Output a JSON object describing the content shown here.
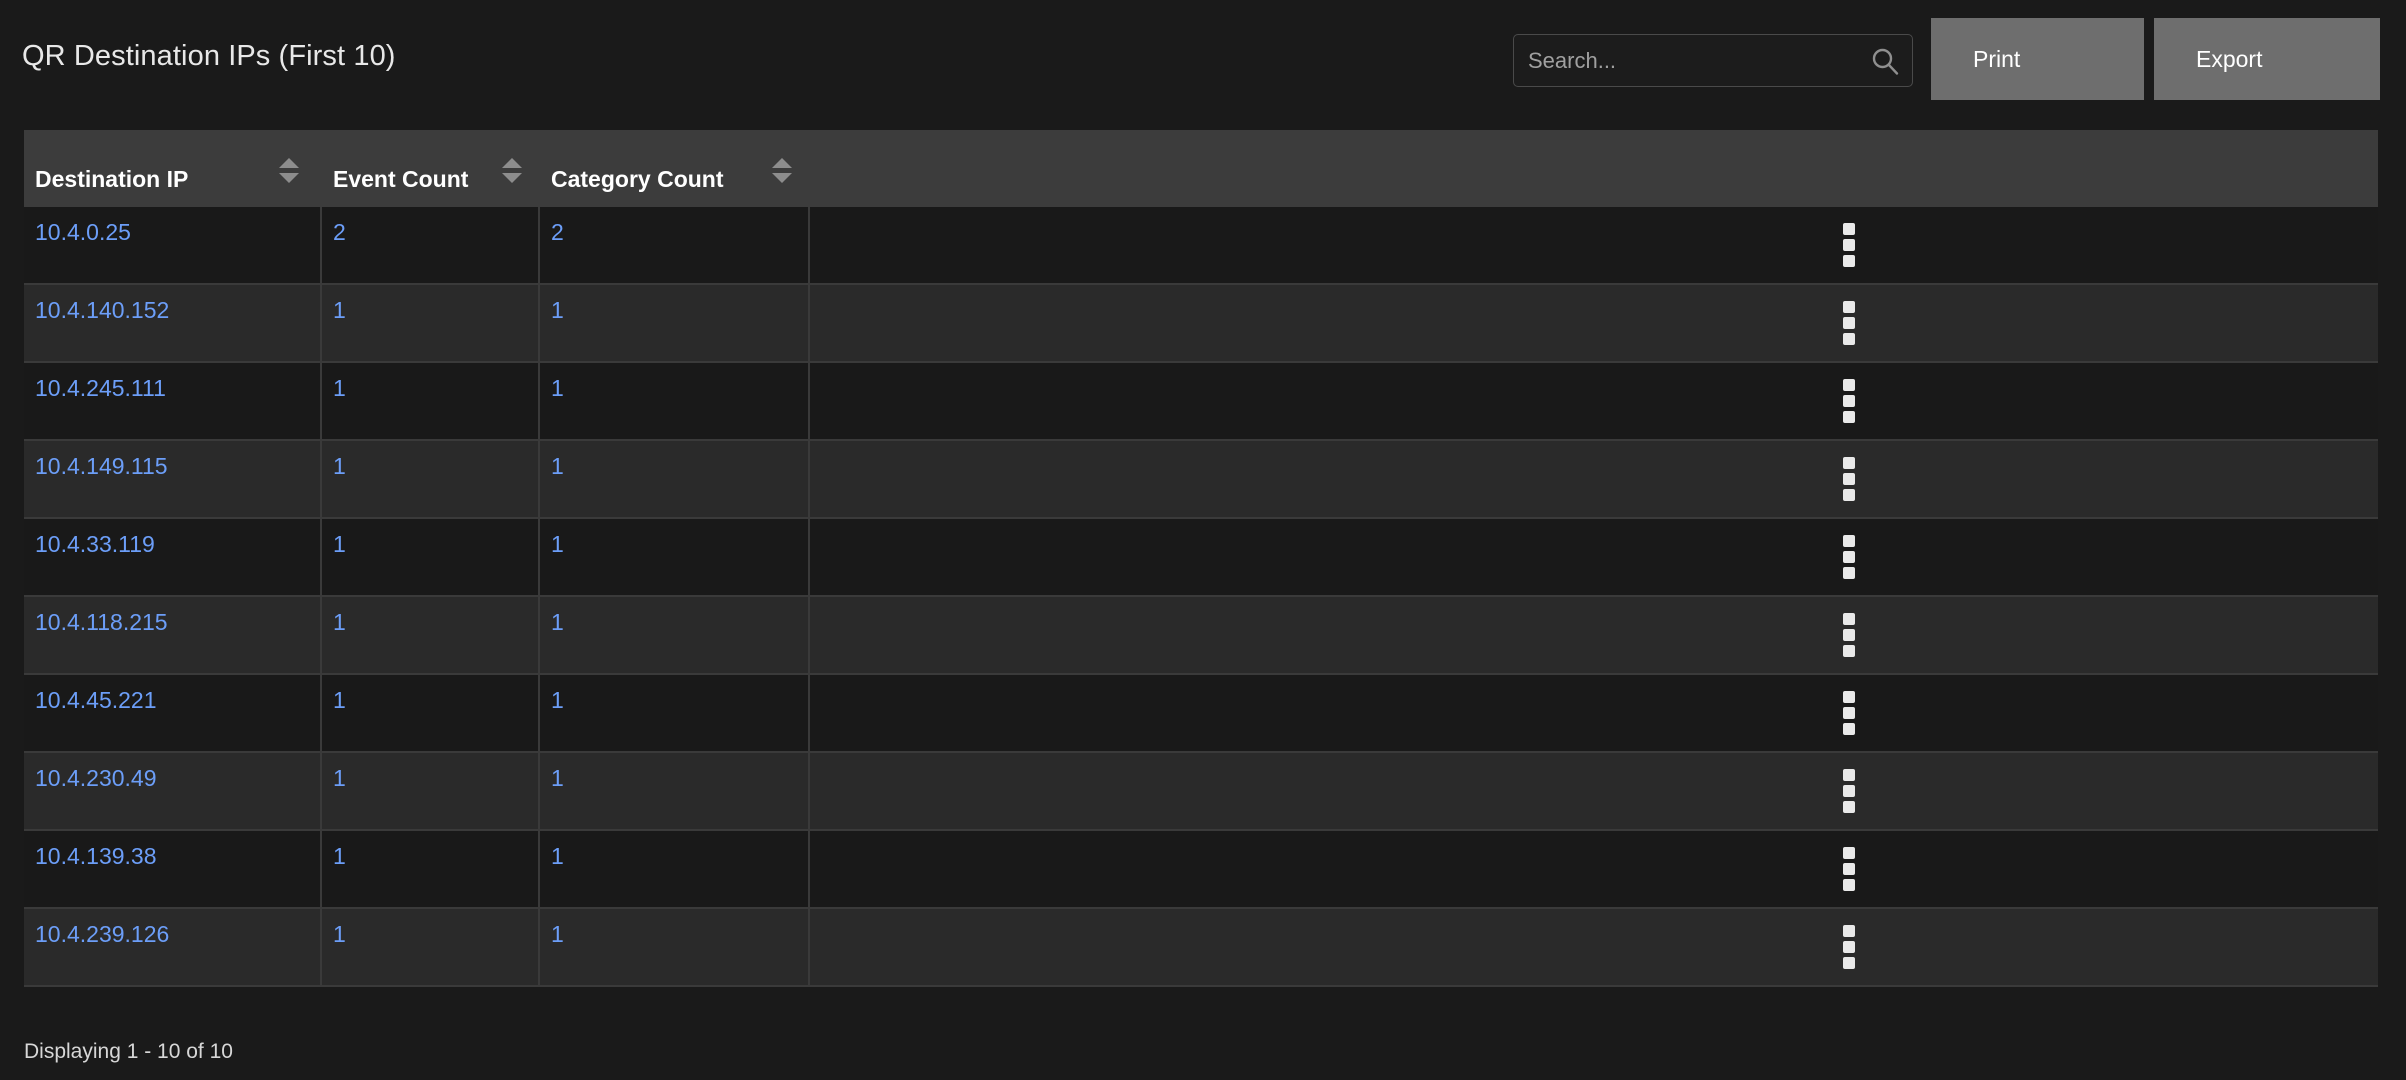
{
  "page": {
    "title": "QR Destination IPs (First 10)",
    "background_color": "#1a1a1a"
  },
  "toolbar": {
    "search": {
      "placeholder": "Search...",
      "value": "",
      "icon": "search-icon"
    },
    "print_label": "Print",
    "export_label": "Export",
    "button_color": "#6e6e6e"
  },
  "table": {
    "header_background": "#3c3c3c",
    "link_color": "#6c9ef8",
    "columns": [
      {
        "label": "Destination IP",
        "sortable": true,
        "sort_icon": "sort-arrows-icon"
      },
      {
        "label": "Event Count",
        "sortable": true,
        "sort_icon": "sort-arrows-icon"
      },
      {
        "label": "Category Count",
        "sortable": true,
        "sort_icon": "sort-arrows-icon"
      },
      {
        "label": "",
        "sortable": false,
        "sort_icon": ""
      }
    ],
    "rows": [
      {
        "destination_ip": "10.4.0.25",
        "event_count": "2",
        "category_count": "2",
        "menu_icon": "kebab-menu-icon"
      },
      {
        "destination_ip": "10.4.140.152",
        "event_count": "1",
        "category_count": "1",
        "menu_icon": "kebab-menu-icon"
      },
      {
        "destination_ip": "10.4.245.111",
        "event_count": "1",
        "category_count": "1",
        "menu_icon": "kebab-menu-icon"
      },
      {
        "destination_ip": "10.4.149.115",
        "event_count": "1",
        "category_count": "1",
        "menu_icon": "kebab-menu-icon"
      },
      {
        "destination_ip": "10.4.33.119",
        "event_count": "1",
        "category_count": "1",
        "menu_icon": "kebab-menu-icon"
      },
      {
        "destination_ip": "10.4.118.215",
        "event_count": "1",
        "category_count": "1",
        "menu_icon": "kebab-menu-icon"
      },
      {
        "destination_ip": "10.4.45.221",
        "event_count": "1",
        "category_count": "1",
        "menu_icon": "kebab-menu-icon"
      },
      {
        "destination_ip": "10.4.230.49",
        "event_count": "1",
        "category_count": "1",
        "menu_icon": "kebab-menu-icon"
      },
      {
        "destination_ip": "10.4.139.38",
        "event_count": "1",
        "category_count": "1",
        "menu_icon": "kebab-menu-icon"
      },
      {
        "destination_ip": "10.4.239.126",
        "event_count": "1",
        "category_count": "1",
        "menu_icon": "kebab-menu-icon"
      }
    ]
  },
  "footer": {
    "status_text": "Displaying 1 - 10 of 10"
  }
}
